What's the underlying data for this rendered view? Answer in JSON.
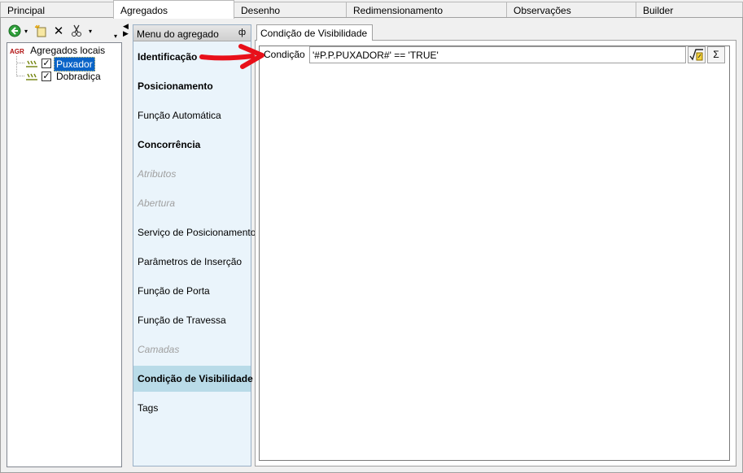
{
  "tabs": [
    {
      "label": "Principal",
      "active": false
    },
    {
      "label": "Agregados",
      "active": true
    },
    {
      "label": "Desenho",
      "active": false
    },
    {
      "label": "Redimensionamento",
      "active": false
    },
    {
      "label": "Observações",
      "active": false
    },
    {
      "label": "Builder",
      "active": false
    }
  ],
  "tree": {
    "root_icon_text": "AGR",
    "root_label": "Agregados locais",
    "items": [
      {
        "label": "Puxador",
        "checked": true,
        "selected": true
      },
      {
        "label": "Dobradiça",
        "checked": true,
        "selected": false
      }
    ]
  },
  "toolbar_icons": [
    "back-arrow-icon",
    "dropdown-icon",
    "new-item-icon",
    "delete-icon",
    "cut-icon",
    "dropdown-icon"
  ],
  "menu": {
    "title": "Menu do agregado",
    "items": [
      {
        "label": "Identificação",
        "style": "bold"
      },
      {
        "label": "Posicionamento",
        "style": "bold"
      },
      {
        "label": "Função Automática",
        "style": "normal"
      },
      {
        "label": "Concorrência",
        "style": "bold"
      },
      {
        "label": "Atributos",
        "style": "disabled"
      },
      {
        "label": "Abertura",
        "style": "disabled"
      },
      {
        "label": "Serviço de Posicionamento",
        "style": "normal"
      },
      {
        "label": "Parâmetros de Inserção",
        "style": "normal"
      },
      {
        "label": "Função de Porta",
        "style": "normal"
      },
      {
        "label": "Função de Travessa",
        "style": "normal"
      },
      {
        "label": "Camadas",
        "style": "disabled"
      },
      {
        "label": "Condição de Visibilidade",
        "style": "active"
      },
      {
        "label": "Tags",
        "style": "normal"
      }
    ]
  },
  "panel": {
    "tab_label": "Condição de Visibilidade",
    "condition_label": "Condição",
    "condition_value": "'#P.P.PUXADOR#' == 'TRUE'",
    "sum_symbol": "Σ"
  },
  "colors": {
    "annotation_arrow": "#e8101a",
    "selection": "#0a64c8",
    "menu_active": "#b9dbe8",
    "menu_bg": "#eaf4fb"
  }
}
